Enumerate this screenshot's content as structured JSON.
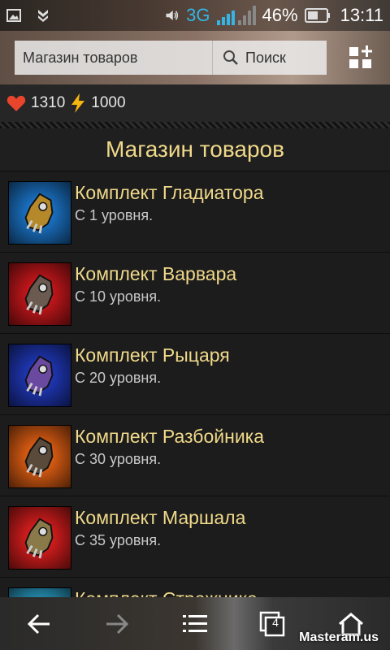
{
  "statusbar": {
    "network": "3G",
    "battery_percent": "46%",
    "time": "13:11"
  },
  "browser": {
    "url_text": "Магазин товаров",
    "search_label": "Поиск"
  },
  "resources": {
    "health": "1310",
    "energy": "1000"
  },
  "shop": {
    "title": "Магазин товаров",
    "items": [
      {
        "name": "Комплект Гладиатора",
        "level": "С 1 уровня.",
        "bg": "#1a6fbf",
        "glove": "#b5882a"
      },
      {
        "name": "Комплект Варвара",
        "level": "С 10 уровня.",
        "bg": "#c0161a",
        "glove": "#6a5a50"
      },
      {
        "name": "Комплект Рыцаря",
        "level": "С 20 уровня.",
        "bg": "#1e35b0",
        "glove": "#6a4aa0"
      },
      {
        "name": "Комплект Разбойника",
        "level": "С 30 уровня.",
        "bg": "#d55a12",
        "glove": "#5a4a3a"
      },
      {
        "name": "Комплект Маршала",
        "level": "С 35 уровня.",
        "bg": "#cf1c1c",
        "glove": "#8a7a4a"
      },
      {
        "name": "Комплект Стражника",
        "level": "",
        "bg": "#2aa0c8",
        "glove": "#7a6a5a"
      }
    ]
  },
  "navbar": {
    "tab_count": "4"
  },
  "watermark": "Masteram.us",
  "colors": {
    "title_gold": "#f0d98a",
    "accent_blue": "#34b5e5"
  }
}
